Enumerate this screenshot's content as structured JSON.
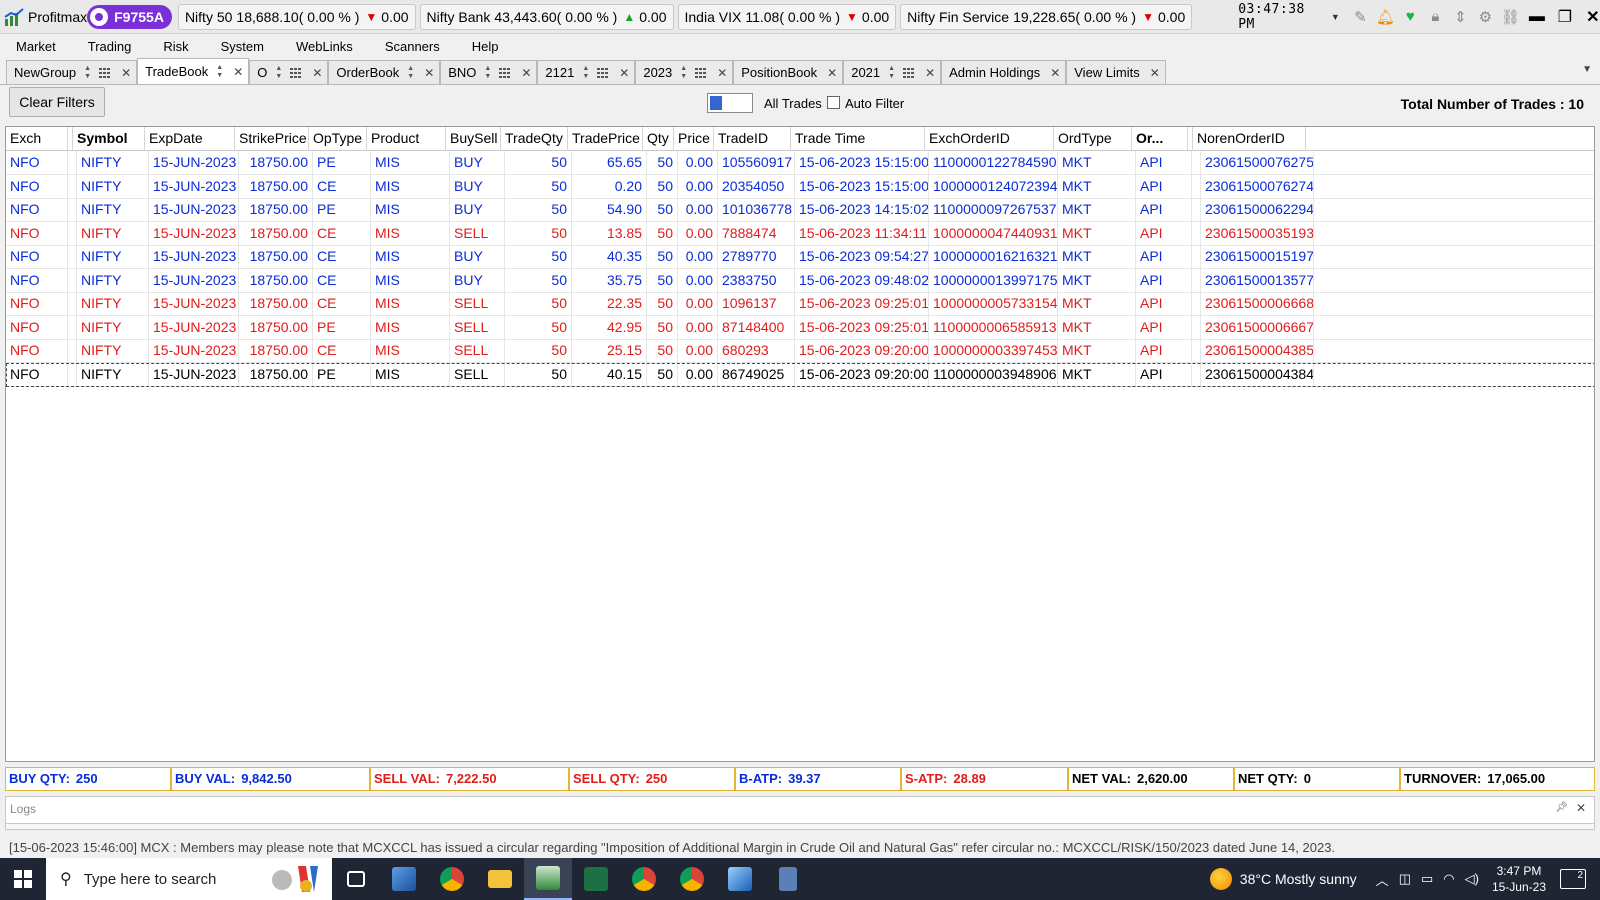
{
  "app": {
    "title": "Profitmax",
    "user_id": "F9755A",
    "clock": "03:47:38 PM"
  },
  "tickers": [
    {
      "name": "Nifty 50",
      "value": "18,688.10",
      "pct": "( 0.00 % )",
      "direction": "down",
      "change": "0.00"
    },
    {
      "name": "Nifty Bank",
      "value": "43,443.60",
      "pct": "( 0.00 % )",
      "direction": "up",
      "change": "0.00"
    },
    {
      "name": "India VIX",
      "value": "11.08",
      "pct": "( 0.00 % )",
      "direction": "down",
      "change": "0.00"
    },
    {
      "name": "Nifty Fin Service",
      "value": "19,228.65",
      "pct": "( 0.00 % )",
      "direction": "down",
      "change": "0.00"
    }
  ],
  "menu": [
    "Market",
    "Trading",
    "Risk",
    "System",
    "WebLinks",
    "Scanners",
    "Help"
  ],
  "tabs": [
    {
      "label": "NewGroup",
      "sort": true,
      "grid": true,
      "close": true
    },
    {
      "label": "TradeBook",
      "sort": true,
      "grid": false,
      "close": true,
      "active": true
    },
    {
      "label": "O",
      "sort": true,
      "grid": true,
      "close": true
    },
    {
      "label": "OrderBook",
      "sort": true,
      "grid": false,
      "close": true
    },
    {
      "label": "BNO",
      "sort": true,
      "grid": true,
      "close": true
    },
    {
      "label": "2121",
      "sort": true,
      "grid": true,
      "close": true
    },
    {
      "label": "2023",
      "sort": true,
      "grid": true,
      "close": true
    },
    {
      "label": "PositionBook",
      "sort": false,
      "grid": false,
      "close": true
    },
    {
      "label": "2021",
      "sort": true,
      "grid": true,
      "close": true
    },
    {
      "label": "Admin Holdings",
      "sort": false,
      "grid": false,
      "close": true
    },
    {
      "label": "View Limits",
      "sort": false,
      "grid": false,
      "close": true
    }
  ],
  "filter": {
    "clear_label": "Clear Filters",
    "toggle_label": "All Trades",
    "auto_filter_label": "Auto Filter",
    "total_label": "Total Number of Trades : 10"
  },
  "columns": [
    "Exch",
    "",
    "Symbol",
    "ExpDate",
    "StrikePrice",
    "OpType",
    "Product",
    "BuySell",
    "TradeQty",
    "TradePrice",
    "Qty",
    "Price",
    "TradeID",
    "Trade Time",
    "ExchOrderID",
    "OrdType",
    "Or...",
    "",
    "NorenOrderID"
  ],
  "trades": [
    {
      "exch": "NFO",
      "symbol": "NIFTY",
      "exp": "15-JUN-2023",
      "strike": "18750.00",
      "optype": "PE",
      "product": "MIS",
      "side": "BUY",
      "tqty": "50",
      "tprice": "65.65",
      "qty": "50",
      "price": "0.00",
      "tradeid": "105560917",
      "time": "15-06-2023 15:15:00",
      "exchorder": "1100000122784590",
      "ordtype": "MKT",
      "or": "API",
      "noren": "23061500076275"
    },
    {
      "exch": "NFO",
      "symbol": "NIFTY",
      "exp": "15-JUN-2023",
      "strike": "18750.00",
      "optype": "CE",
      "product": "MIS",
      "side": "BUY",
      "tqty": "50",
      "tprice": "0.20",
      "qty": "50",
      "price": "0.00",
      "tradeid": "20354050",
      "time": "15-06-2023 15:15:00",
      "exchorder": "1000000124072394",
      "ordtype": "MKT",
      "or": "API",
      "noren": "23061500076274"
    },
    {
      "exch": "NFO",
      "symbol": "NIFTY",
      "exp": "15-JUN-2023",
      "strike": "18750.00",
      "optype": "PE",
      "product": "MIS",
      "side": "BUY",
      "tqty": "50",
      "tprice": "54.90",
      "qty": "50",
      "price": "0.00",
      "tradeid": "101036778",
      "time": "15-06-2023 14:15:02",
      "exchorder": "1100000097267537",
      "ordtype": "MKT",
      "or": "API",
      "noren": "23061500062294"
    },
    {
      "exch": "NFO",
      "symbol": "NIFTY",
      "exp": "15-JUN-2023",
      "strike": "18750.00",
      "optype": "CE",
      "product": "MIS",
      "side": "SELL",
      "tqty": "50",
      "tprice": "13.85",
      "qty": "50",
      "price": "0.00",
      "tradeid": "7888474",
      "time": "15-06-2023 11:34:11",
      "exchorder": "1000000047440931",
      "ordtype": "MKT",
      "or": "API",
      "noren": "23061500035193"
    },
    {
      "exch": "NFO",
      "symbol": "NIFTY",
      "exp": "15-JUN-2023",
      "strike": "18750.00",
      "optype": "CE",
      "product": "MIS",
      "side": "BUY",
      "tqty": "50",
      "tprice": "40.35",
      "qty": "50",
      "price": "0.00",
      "tradeid": "2789770",
      "time": "15-06-2023 09:54:27",
      "exchorder": "1000000016216321",
      "ordtype": "MKT",
      "or": "API",
      "noren": "23061500015197"
    },
    {
      "exch": "NFO",
      "symbol": "NIFTY",
      "exp": "15-JUN-2023",
      "strike": "18750.00",
      "optype": "CE",
      "product": "MIS",
      "side": "BUY",
      "tqty": "50",
      "tprice": "35.75",
      "qty": "50",
      "price": "0.00",
      "tradeid": "2383750",
      "time": "15-06-2023 09:48:02",
      "exchorder": "1000000013997175",
      "ordtype": "MKT",
      "or": "API",
      "noren": "23061500013577"
    },
    {
      "exch": "NFO",
      "symbol": "NIFTY",
      "exp": "15-JUN-2023",
      "strike": "18750.00",
      "optype": "CE",
      "product": "MIS",
      "side": "SELL",
      "tqty": "50",
      "tprice": "22.35",
      "qty": "50",
      "price": "0.00",
      "tradeid": "1096137",
      "time": "15-06-2023 09:25:01",
      "exchorder": "1000000005733154",
      "ordtype": "MKT",
      "or": "API",
      "noren": "23061500006668"
    },
    {
      "exch": "NFO",
      "symbol": "NIFTY",
      "exp": "15-JUN-2023",
      "strike": "18750.00",
      "optype": "PE",
      "product": "MIS",
      "side": "SELL",
      "tqty": "50",
      "tprice": "42.95",
      "qty": "50",
      "price": "0.00",
      "tradeid": "87148400",
      "time": "15-06-2023 09:25:01",
      "exchorder": "1100000006585913",
      "ordtype": "MKT",
      "or": "API",
      "noren": "23061500006667"
    },
    {
      "exch": "NFO",
      "symbol": "NIFTY",
      "exp": "15-JUN-2023",
      "strike": "18750.00",
      "optype": "CE",
      "product": "MIS",
      "side": "SELL",
      "tqty": "50",
      "tprice": "25.15",
      "qty": "50",
      "price": "0.00",
      "tradeid": "680293",
      "time": "15-06-2023 09:20:00",
      "exchorder": "1000000003397453",
      "ordtype": "MKT",
      "or": "API",
      "noren": "23061500004385"
    },
    {
      "exch": "NFO",
      "symbol": "NIFTY",
      "exp": "15-JUN-2023",
      "strike": "18750.00",
      "optype": "PE",
      "product": "MIS",
      "side": "SELL",
      "tqty": "50",
      "tprice": "40.15",
      "qty": "50",
      "price": "0.00",
      "tradeid": "86749025",
      "time": "15-06-2023 09:20:00",
      "exchorder": "1100000003948906",
      "ordtype": "MKT",
      "or": "API",
      "noren": "23061500004384",
      "selected": true
    }
  ],
  "summary": [
    {
      "label": "BUY QTY:",
      "value": "250",
      "tone": "blue"
    },
    {
      "label": "BUY VAL:",
      "value": "9,842.50",
      "tone": "blue"
    },
    {
      "label": "SELL VAL:",
      "value": "7,222.50",
      "tone": "red"
    },
    {
      "label": "SELL QTY:",
      "value": "250",
      "tone": "red"
    },
    {
      "label": "B-ATP:",
      "value": "39.37",
      "tone": "blue"
    },
    {
      "label": "S-ATP:",
      "value": "28.89",
      "tone": "red"
    },
    {
      "label": "NET VAL:",
      "value": "2,620.00",
      "tone": "black"
    },
    {
      "label": "NET QTY:",
      "value": "0",
      "tone": "black"
    },
    {
      "label": "TURNOVER:",
      "value": "17,065.00",
      "tone": "black"
    }
  ],
  "logs": {
    "title": "Logs",
    "line": "[15-06-2023 15:46:00] MCX : Members may please note that MCXCCL has issued a circular regarding \"Imposition of Additional Margin in Crude Oil and Natural Gas\" refer circular no.: MCXCCL/RISK/150/2023 dated June 14, 2023."
  },
  "taskbar": {
    "search_placeholder": "Type here to search",
    "weather": "38°C  Mostly sunny",
    "time": "3:47 PM",
    "date": "15-Jun-23",
    "notifications": "2"
  },
  "colors": {
    "buy": "#0a2bd6",
    "sell": "#e21b1b",
    "user_pill": "#7b2fd6",
    "summary_border": "#e3b531"
  }
}
